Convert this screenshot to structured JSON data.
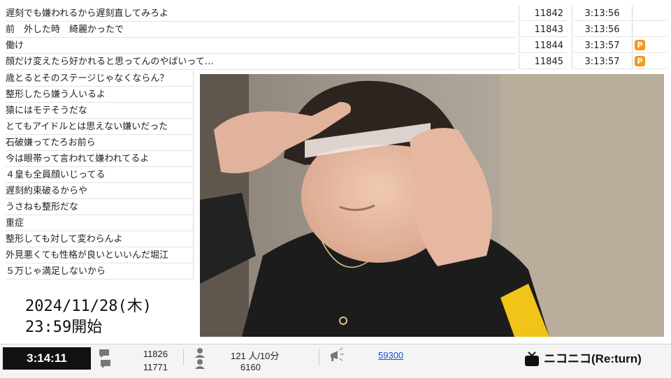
{
  "comments": [
    {
      "text": "遅刻でも嫌われるから遅刻直してみろよ",
      "no": "11842",
      "time": "3:13:56",
      "premium": false
    },
    {
      "text": "前　外した時　綺麗かったで",
      "no": "11843",
      "time": "3:13:56",
      "premium": false
    },
    {
      "text": "働け",
      "no": "11844",
      "time": "3:13:57",
      "premium": true
    },
    {
      "text": "顔だけ変えたら好かれると思ってんのやばいって…",
      "no": "11845",
      "time": "3:13:57",
      "premium": true
    }
  ],
  "side_comments": [
    "歳とるとそのステージじゃなくならん？",
    "整形したら嫌う人いるよ",
    "猿にはモテそうだな",
    "とてもアイドルとは思えない嫌いだった",
    "石破嫌ってたろお前ら",
    "今は眼帯って言われて嫌われてるよ",
    "４皇も全員顔いじってる",
    "遅刻約束破るからや",
    "うさねも整形だな",
    "重症",
    "整形しても対して変わらんよ",
    "外見悪くても性格が良いといいんだ堀江",
    "５万じゃ満足しないから"
  ],
  "badge_label": "P",
  "broadcast": {
    "date": "2024/11/28(木)",
    "start": "23:59開始"
  },
  "bottom": {
    "elapsed": "3:14:11",
    "comments_total": "11826",
    "comments_sub": "11771",
    "viewers_rate": "121 人/10分",
    "viewers_total": "6160",
    "points": "59300",
    "logo_text": "ニコニコ(Re:turn)"
  },
  "icons": {
    "comment": "speech-bubble-icon",
    "viewer": "person-icon",
    "ad": "megaphone-icon",
    "logo": "tv-icon"
  }
}
